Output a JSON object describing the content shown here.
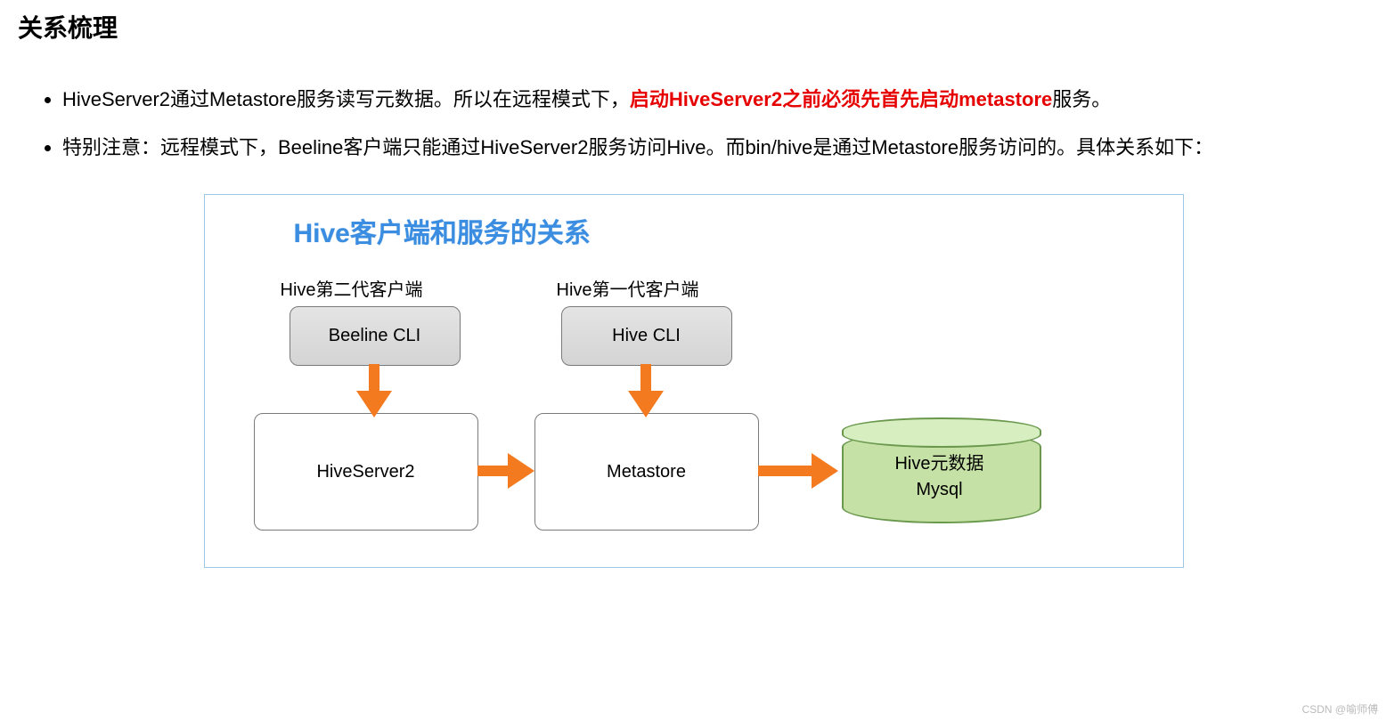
{
  "heading": "关系梳理",
  "bullets": {
    "b1_a": "HiveServer2通过Metastore服务读写元数据。所以在远程模式下，",
    "b1_em": "启动HiveServer2之前必须先首先启动metastore",
    "b1_b": "服务。",
    "b2": "特别注意：远程模式下，Beeline客户端只能通过HiveServer2服务访问Hive。而bin/hive是通过Metastore服务访问的。具体关系如下："
  },
  "diagram": {
    "title": "Hive客户端和服务的关系",
    "label_gen2": "Hive第二代客户端",
    "label_gen1": "Hive第一代客户端",
    "box_beeline": "Beeline CLI",
    "box_hivecli": "Hive CLI",
    "box_hs2": "HiveServer2",
    "box_metastore": "Metastore",
    "cyl_line1": "Hive元数据",
    "cyl_line2": "Mysql"
  },
  "watermark": "CSDN @喻师傅"
}
